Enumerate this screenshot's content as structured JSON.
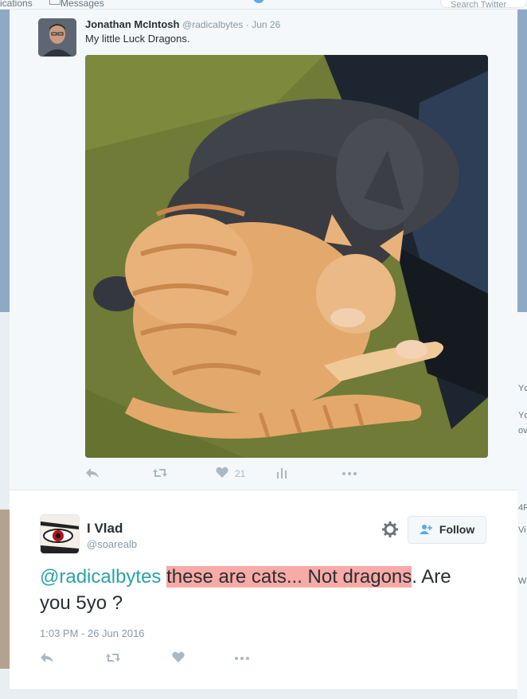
{
  "background_nav": {
    "notifications_label": "ications",
    "messages_label": "Messages",
    "search_placeholder": "Search Twitter",
    "right_edge_texts": [
      "Yc",
      "Yc",
      "ov",
      "4R",
      "Vi",
      "W"
    ]
  },
  "tweet1": {
    "author_name": "Jonathan McIntosh",
    "author_handle": "@radicalbytes",
    "date": "· Jun 26",
    "text": "My little Luck Dragons.",
    "likes_count": "21",
    "icons": [
      "reply-icon",
      "retweet-icon",
      "heart-icon",
      "analytics-icon",
      "more-icon"
    ]
  },
  "tweet2": {
    "author_name": "I Vlad",
    "author_handle": "@soarealb",
    "follow_label": "Follow",
    "text_mention": "@radicalbytes",
    "text_highlight": "these are cats... Not dragons",
    "text_rest_1": ". Are",
    "text_rest_2": "you 5yo ?",
    "timestamp": "1:03 PM - 26 Jun 2016",
    "icons": [
      "reply-icon",
      "retweet-icon",
      "heart-icon",
      "more-icon"
    ]
  },
  "colors": {
    "mention": "#2aa3a8",
    "highlight": "#f7aaa6",
    "action_icons": "#aab8c2",
    "twitter_blue": "#55acee"
  }
}
